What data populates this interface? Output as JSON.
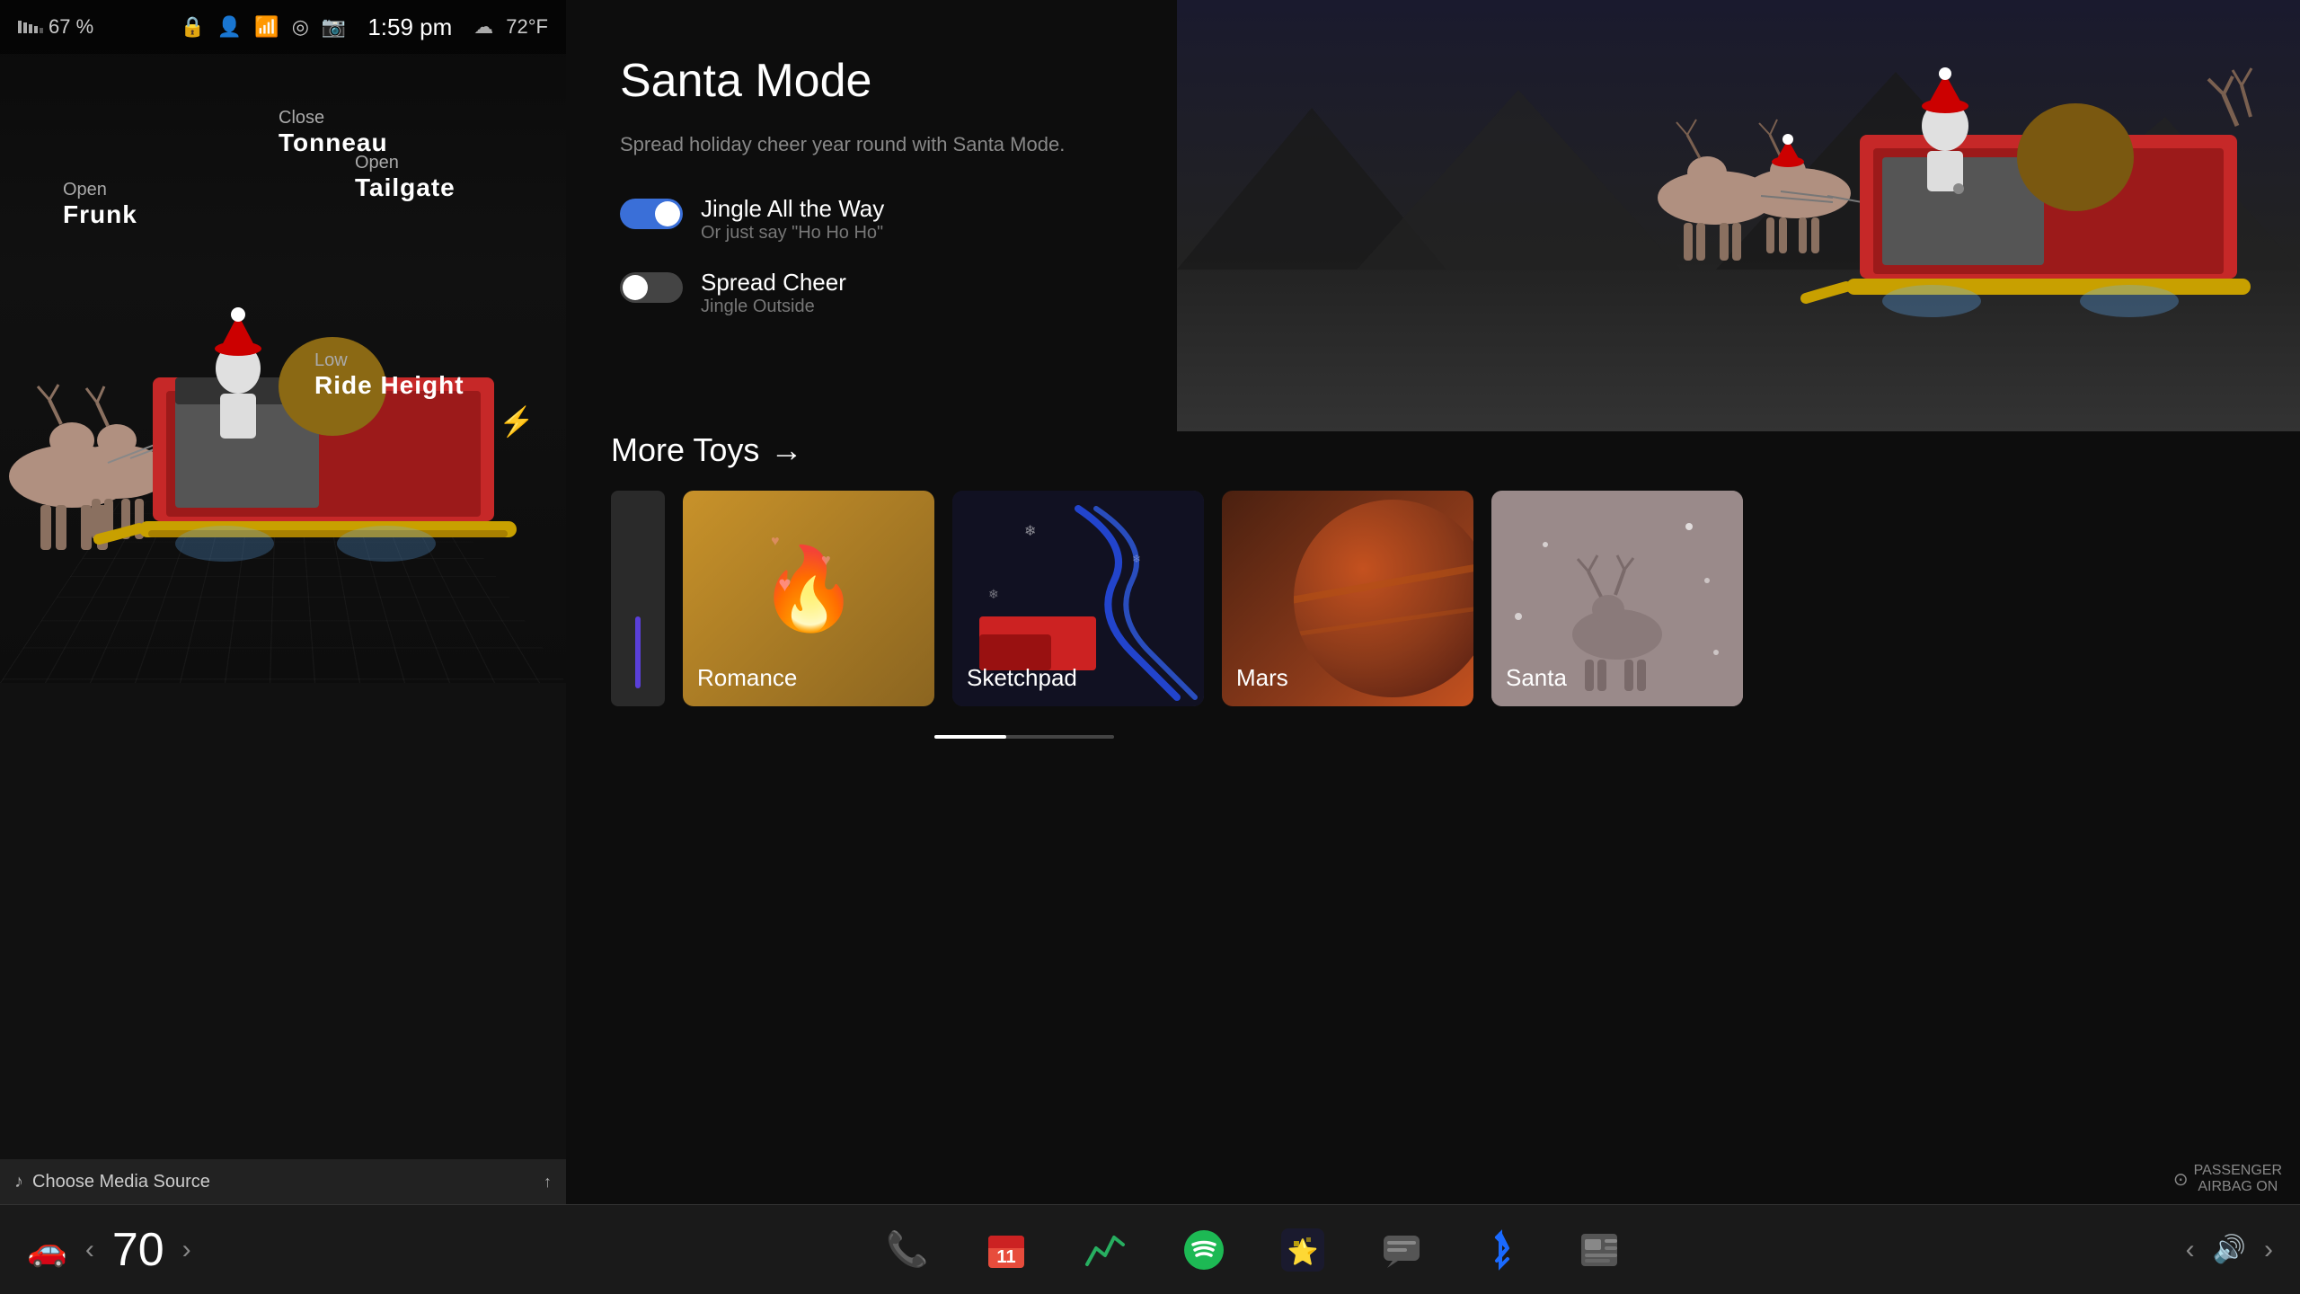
{
  "statusBar": {
    "batteryPercent": "67 %",
    "time": "1:59 pm",
    "weather": "72°F"
  },
  "vehicleLabels": {
    "frunk": {
      "action": "Open",
      "name": "Frunk"
    },
    "tonneau": {
      "action": "Close",
      "name": "Tonneau"
    },
    "tailgate": {
      "action": "Open",
      "name": "Tailgate"
    },
    "rideHeight": {
      "action": "Low",
      "name": "Ride Height"
    }
  },
  "santaMode": {
    "title": "Santa Mode",
    "description": "Spread holiday cheer year round with Santa Mode.",
    "options": [
      {
        "id": "jingle",
        "title": "Jingle All the Way",
        "subtitle": "Or just say \"Ho Ho Ho\"",
        "enabled": true
      },
      {
        "id": "cheer",
        "title": "Spread Cheer",
        "subtitle": "Jingle Outside",
        "enabled": false
      }
    ]
  },
  "moreToys": {
    "label": "More Toys",
    "arrow": "→",
    "cards": [
      {
        "id": "romance",
        "label": "Romance",
        "emoji": "🔥",
        "type": "romance"
      },
      {
        "id": "sketchpad",
        "label": "Sketchpad",
        "type": "sketchpad"
      },
      {
        "id": "mars",
        "label": "Mars",
        "type": "mars"
      },
      {
        "id": "santa",
        "label": "Santa",
        "type": "santa"
      }
    ]
  },
  "taskbar": {
    "speed": "70",
    "apps": [
      {
        "id": "phone",
        "icon": "📞",
        "label": "Phone"
      },
      {
        "id": "calendar",
        "icon": "📅",
        "label": "Calendar"
      },
      {
        "id": "chart",
        "icon": "📈",
        "label": "Energy"
      },
      {
        "id": "spotify",
        "icon": "🎵",
        "label": "Spotify"
      },
      {
        "id": "star",
        "icon": "⭐",
        "label": "Favorites"
      },
      {
        "id": "chat",
        "icon": "💬",
        "label": "Messages"
      },
      {
        "id": "bluetooth",
        "icon": "⬡",
        "label": "Bluetooth"
      },
      {
        "id": "news",
        "icon": "📰",
        "label": "News"
      }
    ]
  },
  "mediaBar": {
    "icon": "♪",
    "text": "Choose Media Source",
    "action": "↑"
  },
  "passengerAirbag": {
    "label": "PASSENGER\nAIRBAG ON"
  }
}
